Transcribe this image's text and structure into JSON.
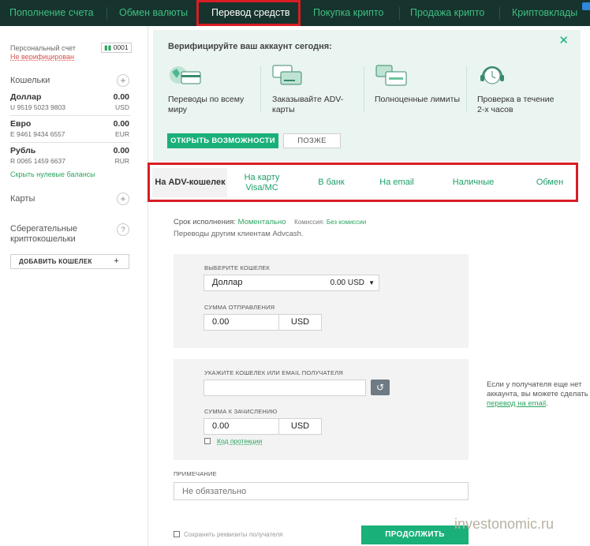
{
  "topnav": {
    "items": [
      "Пополнение счета",
      "Обмен валюты",
      "Перевод средств",
      "Покупка крипто",
      "Продажа крипто",
      "Криптовклады"
    ],
    "active_index": 2
  },
  "sidebar": {
    "account_label": "Персональный счет",
    "account_status": "Не верифицирован",
    "account_level": "0001",
    "wallets_title": "Кошельки",
    "wallets": [
      {
        "name": "Доллар",
        "number": "U 9519 5023 9803",
        "balance": "0.00",
        "currency": "USD"
      },
      {
        "name": "Евро",
        "number": "E 9461 9434 6557",
        "balance": "0.00",
        "currency": "EUR"
      },
      {
        "name": "Рубль",
        "number": "R 0065 1459 6637",
        "balance": "0.00",
        "currency": "RUR"
      }
    ],
    "hide_zero": "Скрыть нулевые балансы",
    "cards_title": "Карты",
    "savings_title": "Сберегательные криптокошельки",
    "add_wallet": "ДОБАВИТЬ КОШЕЛЕК"
  },
  "verify": {
    "title": "Верифицируйте ваш аккаунт сегодня:",
    "features": [
      "Переводы по всему миру",
      "Заказывайте ADV-карты",
      "Полноценные лимиты",
      "Проверка в течение 2-х часов"
    ],
    "primary_button": "ОТКРЫТЬ ВОЗМОЖНОСТИ",
    "secondary_button": "ПОЗЖЕ"
  },
  "tabs": [
    "На ADV-кошелек",
    "На карту Visa/MC",
    "В банк",
    "На email",
    "Наличные",
    "Обмен"
  ],
  "form": {
    "term_label": "Срок исполнения:",
    "term_value": "Моментально",
    "fee_label": "Комиссия:",
    "fee_value": "Без комиссии",
    "description": "Переводы другим клиентам Advcash.",
    "choose_wallet_label": "ВЫБЕРИТЕ КОШЕЛЕК",
    "wallet_selected": "Доллар",
    "wallet_balance": "0.00 USD",
    "send_amount_label": "СУММА ОТПРАВЛЕНИЯ",
    "send_amount": "0.00",
    "send_currency": "USD",
    "recipient_label": "УКАЖИТЕ КОШЕЛЕК ИЛИ EMAIL ПОЛУЧАТЕЛЯ",
    "recipient_value": "",
    "receive_amount_label": "СУММА К ЗАЧИСЛЕНИЮ",
    "receive_amount": "0.00",
    "receive_currency": "USD",
    "protection_code": "Код протекции",
    "hint_text": "Если у получателя еще нет аккаунта, вы можете сделать",
    "hint_link": "перевод на email",
    "note_label": "ПРИМЕЧАНИЕ",
    "note_placeholder": "Не обязательно",
    "save_details": "Сохранить реквизиты получателя",
    "continue_button": "ПРОДОЛЖИТЬ"
  },
  "watermark": "investonomic.ru",
  "colors": {
    "accent": "#1ab07a",
    "nav_bg": "#16332d",
    "highlight": "#d81d24"
  }
}
